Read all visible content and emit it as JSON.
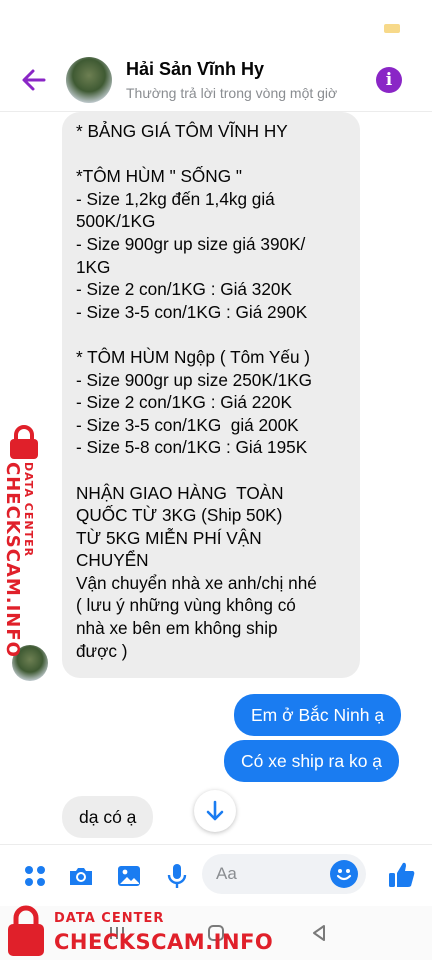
{
  "header": {
    "title": "Hải Sản Vĩnh Hy",
    "subtitle": "Thường trả lời trong vòng một giờ",
    "back_icon": "back-arrow-icon",
    "info_icon": "info-icon"
  },
  "conversation": {
    "incoming_long_lines": [
      "* BẢNG GIÁ TÔM VĨNH HY",
      "",
      "*TÔM HÙM \" SỐNG \"",
      "- Size 1,2kg đến 1,4kg giá",
      "500K/1KG",
      "- Size 900gr up size giá 390K/",
      "1KG",
      "- Size 2 con/1KG : Giá 320K",
      "- Size 3-5 con/1KG : Giá 290K",
      "",
      "* TÔM HÙM Ngộp ( Tôm Yếu )",
      "- Size 900gr up size 250K/1KG",
      "- Size 2 con/1KG : Giá 220K",
      "- Size 3-5 con/1KG  giá 200K",
      "- Size 5-8 con/1KG : Giá 195K",
      "",
      "NHẬN GIAO HÀNG  TOÀN",
      "QUỐC TỪ 3KG (Ship 50K)",
      "TỪ 5KG MIỄN PHÍ VẬN",
      "CHUYỂN",
      "Vận chuyển nhà xe anh/chị nhé",
      "( lưu ý những vùng không có",
      "nhà xe bên em không ship",
      "được )"
    ],
    "outgoing_1": "Em ở Bắc Ninh ạ",
    "outgoing_2": "Có xe ship ra ko ạ",
    "incoming_short": "dạ có ạ"
  },
  "composer": {
    "placeholder": "Aa",
    "icons": [
      "apps-grid-icon",
      "camera-icon",
      "gallery-icon",
      "microphone-icon",
      "emoji-icon",
      "thumbs-up-icon"
    ]
  },
  "watermark": {
    "small": "DATA CENTER",
    "large": "CHECKSCAM.INFO",
    "color": "#e0202a"
  },
  "colors": {
    "messenger_blue": "#1a7cf1",
    "header_purple": "#8a26c6",
    "incoming_bubble": "#ededed"
  }
}
